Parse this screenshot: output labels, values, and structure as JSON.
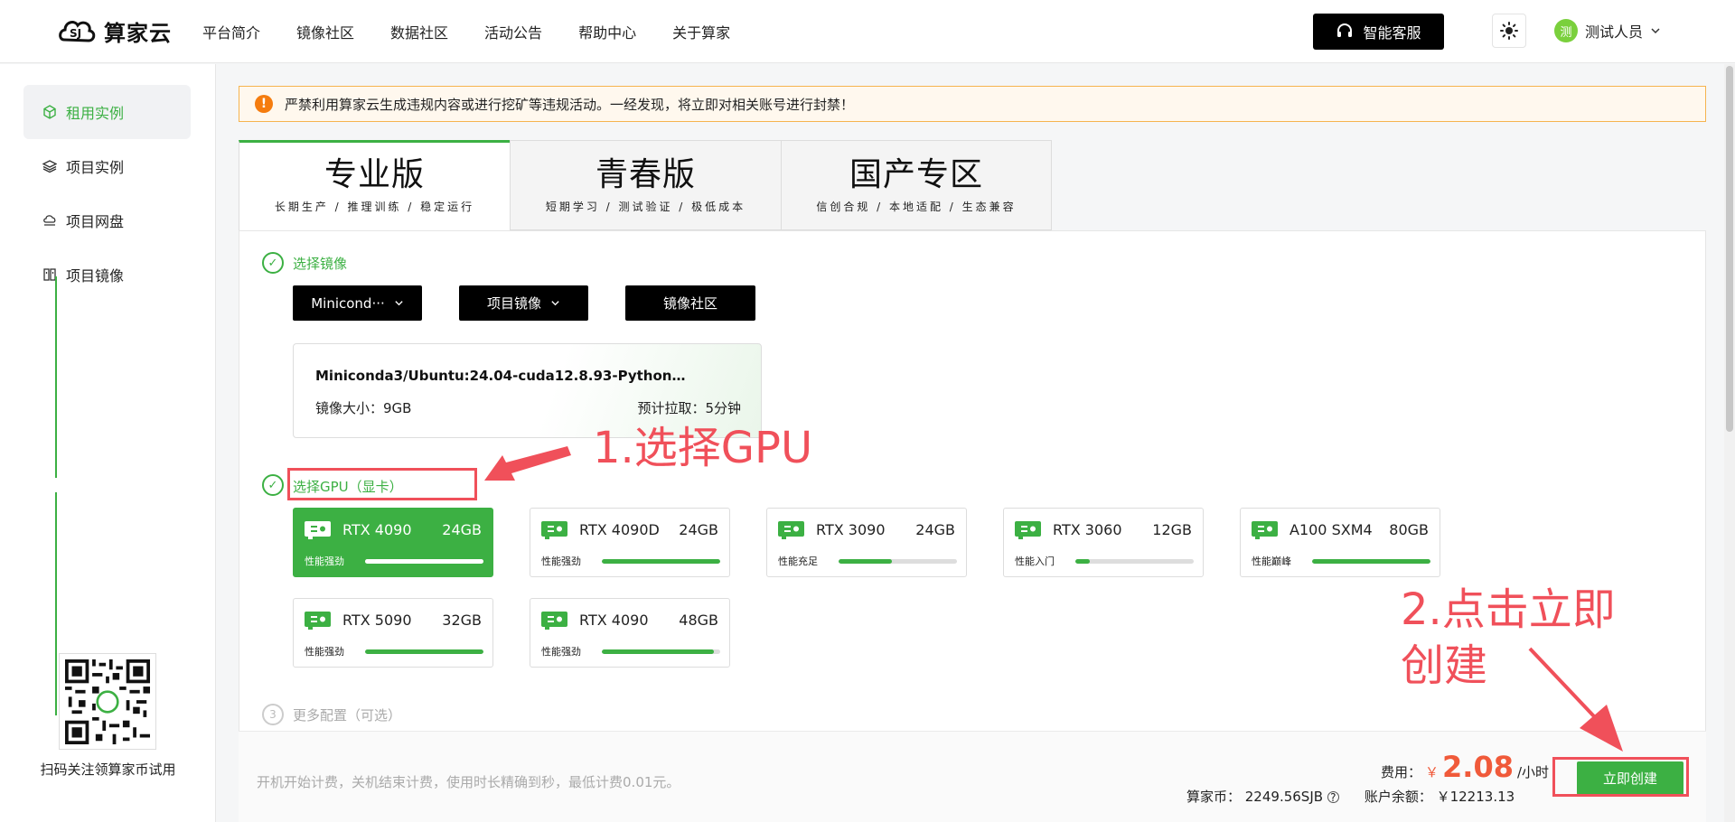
{
  "header": {
    "logo_text": "算家云",
    "nav": [
      "平台简介",
      "镜像社区",
      "数据社区",
      "活动公告",
      "帮助中心",
      "关于算家"
    ],
    "service_label": "智能客服",
    "user_avatar_char": "测",
    "user_name": "测试人员"
  },
  "sidebar": {
    "items": [
      {
        "label": "租用实例",
        "icon": "cube-icon",
        "active": true
      },
      {
        "label": "项目实例",
        "icon": "layers-icon",
        "active": false
      },
      {
        "label": "项目网盘",
        "icon": "cloud-drive-icon",
        "active": false
      },
      {
        "label": "项目镜像",
        "icon": "image-icon",
        "active": false
      }
    ],
    "qr_caption": "扫码关注领算家币试用"
  },
  "alert": {
    "text": "严禁利用算家云生成违规内容或进行挖矿等违规活动。一经发现，将立即对相关账号进行封禁！"
  },
  "tabs": [
    {
      "title": "专业版",
      "sub": "长期生产 / 推理训练 / 稳定运行",
      "active": true
    },
    {
      "title": "青春版",
      "sub": "短期学习 / 测试验证 / 极低成本",
      "active": false
    },
    {
      "title": "国产专区",
      "sub": "信创合规 / 本地适配 / 生态兼容",
      "active": false
    }
  ],
  "steps": {
    "image": "选择镜像",
    "gpu": "选择GPU（显卡）",
    "more": "更多配置（可选）",
    "more_number": "3"
  },
  "image_buttons": {
    "system": "Minicond···",
    "project": "项目镜像",
    "community": "镜像社区"
  },
  "image_card": {
    "name": "Miniconda3/Ubuntu:24.04-cuda12.8.93-Python…",
    "size": "镜像大小：9GB",
    "pull": "预计拉取：5分钟"
  },
  "gpus": [
    {
      "name": "RTX 4090",
      "mem": "24GB",
      "perf": "性能强劲",
      "level": 1.0,
      "selected": true
    },
    {
      "name": "RTX 4090D",
      "mem": "24GB",
      "perf": "性能强劲",
      "level": 1.0,
      "selected": false
    },
    {
      "name": "RTX 3090",
      "mem": "24GB",
      "perf": "性能充足",
      "level": 0.45,
      "selected": false
    },
    {
      "name": "RTX 3060",
      "mem": "12GB",
      "perf": "性能入门",
      "level": 0.12,
      "selected": false
    },
    {
      "name": "A100 SXM4",
      "mem": "80GB",
      "perf": "性能巅峰",
      "level": 1.0,
      "selected": false
    },
    {
      "name": "RTX 5090",
      "mem": "32GB",
      "perf": "性能强劲",
      "level": 1.0,
      "selected": false
    },
    {
      "name": "RTX 4090",
      "mem": "48GB",
      "perf": "性能强劲",
      "level": 0.95,
      "selected": false
    }
  ],
  "footer": {
    "billing_note": "开机开始计费，关机结束计费，使用时长精确到秒，最低计费0.01元。",
    "fee_label": "费用：",
    "fee_currency": "￥",
    "fee_amount": "2.08",
    "fee_unit": "/小时",
    "coin": "算家币： 2249.56SJB",
    "balance": "账户余额： ￥12213.13",
    "create_label": "立即创建"
  },
  "annotations": {
    "step1": "1.选择GPU",
    "step2_line1": "2.点击立即",
    "step2_line2": "创建"
  },
  "colors": {
    "brand_green": "#3cb043",
    "annotation_red": "#f0505a",
    "price_red": "#f05a3a",
    "alert_orange": "#f57c0e"
  }
}
